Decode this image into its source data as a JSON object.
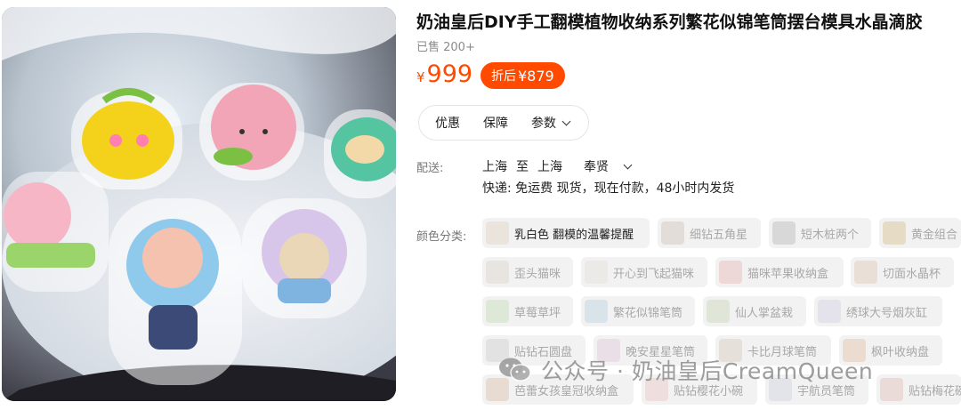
{
  "product": {
    "title": "奶油皇后DIY手工翻模植物收纳系列繁花似锦笔筒摆台模具水晶滴胶",
    "sold": "已售 200+",
    "currency": "¥",
    "price": "999",
    "discount_label": "折后",
    "discount_price": "¥879",
    "accent_color": "#ff4a00"
  },
  "tabs": [
    {
      "label": "优惠"
    },
    {
      "label": "保障"
    },
    {
      "label": "参数"
    }
  ],
  "shipping": {
    "label": "配送:",
    "from": "上海",
    "to_word": "至",
    "to": "上海",
    "district": "奉贤",
    "detail": "快递: 免运费  现货，现在付款，48小时内发货"
  },
  "colors": {
    "label": "颜色分类:",
    "options": [
      {
        "label": "乳白色 翻模的温馨提醒"
      },
      {
        "label": "细钻五角星"
      },
      {
        "label": "短木桩两个"
      },
      {
        "label": "黄金组合"
      },
      {
        "label": "歪头猫咪"
      },
      {
        "label": "开心到飞起猫咪"
      },
      {
        "label": "猫咪苹果收纳盒"
      },
      {
        "label": "切面水晶杯"
      },
      {
        "label": "草莓草坪"
      },
      {
        "label": "繁花似锦笔筒"
      },
      {
        "label": "仙人掌盆栽"
      },
      {
        "label": "绣球大号烟灰缸"
      },
      {
        "label": "贴钻石圆盘"
      },
      {
        "label": "晚安星星笔筒"
      },
      {
        "label": "卡比月球笔筒"
      },
      {
        "label": "枫叶收纳盘"
      },
      {
        "label": "芭蕾女孩皇冠收纳盒"
      },
      {
        "label": "贴钻樱花小碗"
      },
      {
        "label": "宇航员笔筒"
      },
      {
        "label": "贴钻梅花碗"
      }
    ]
  },
  "watermark": {
    "text": "公众号 · 奶油皇后CreamQueen"
  }
}
